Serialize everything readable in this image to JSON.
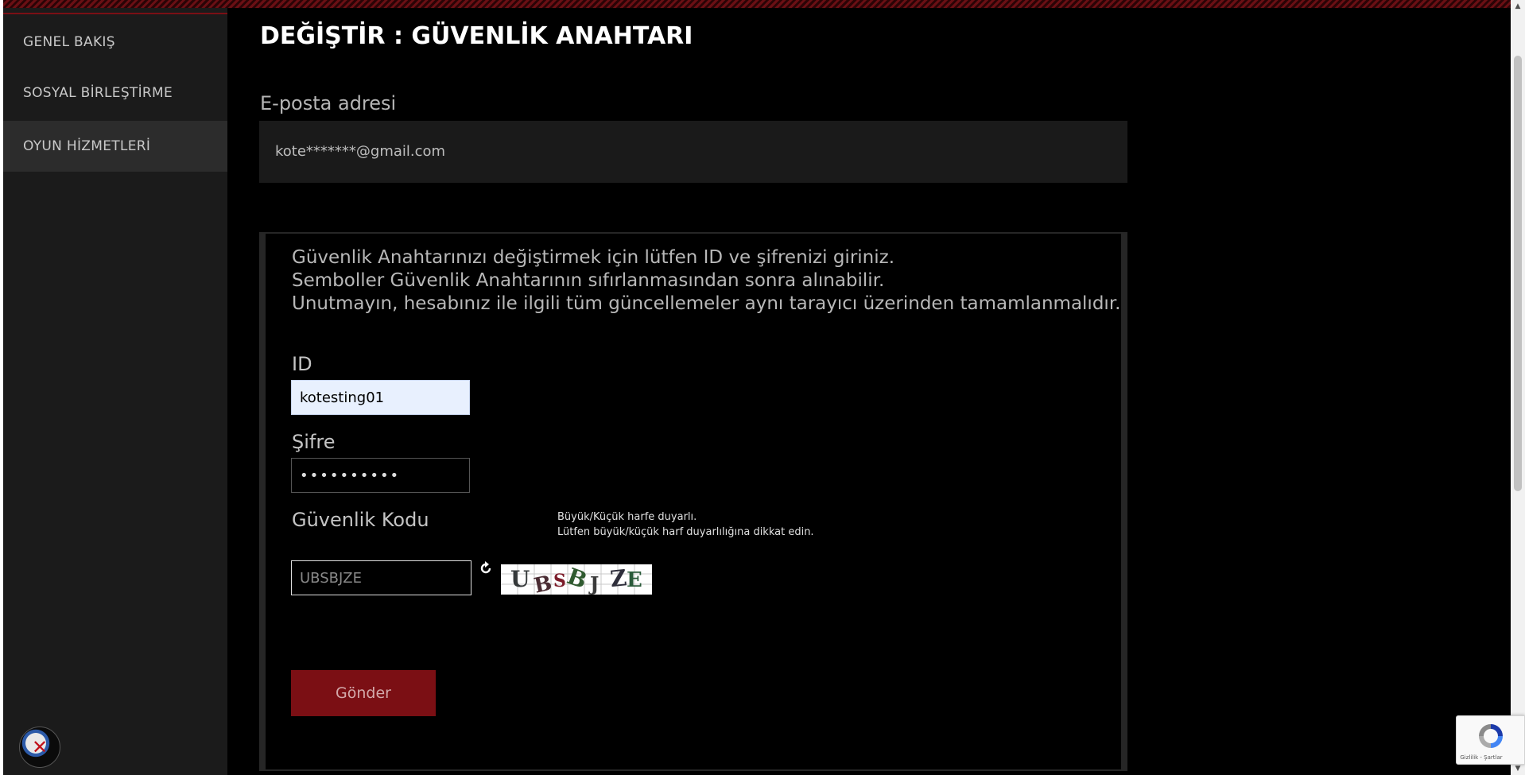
{
  "sidebar": {
    "items": [
      {
        "label": "GENEL BAKIŞ",
        "active": false
      },
      {
        "label": "SOSYAL BİRLEŞTİRME",
        "active": false
      },
      {
        "label": "OYUN HİZMETLERİ",
        "active": true
      }
    ],
    "logo_icon": "game-logo-icon"
  },
  "page": {
    "title": "DEĞİŞTİR : GÜVENLİK ANAHTARI"
  },
  "email": {
    "label": "E-posta adresi",
    "value": "kote*******@gmail.com"
  },
  "form": {
    "instructions": [
      "Güvenlik Anahtarınızı değiştirmek için lütfen ID ve şifrenizi giriniz.",
      "Semboller Güvenlik Anahtarının sıfırlanmasından sonra alınabilir.",
      "Unutmayın, hesabınız ile ilgili tüm güncellemeler aynı tarayıcı üzerinden tamamlanmalıdır."
    ],
    "id_label": "ID",
    "id_value": "kotesting01",
    "password_label": "Şifre",
    "password_value": "••••••••••",
    "security_code_label": "Güvenlik Kodu",
    "case_note_line1": "Büyük/Küçük harfe duyarlı.",
    "case_note_line2": "Lütfen büyük/küçük harf duyarlılığına dikkat edin.",
    "captcha_placeholder": "UBSBJZE",
    "captcha_text": "UBSBJZE",
    "refresh_icon": "refresh-icon",
    "submit_label": "Gönder"
  },
  "recaptcha": {
    "terms": "Gizlilik - Şartlar"
  },
  "colors": {
    "accent": "#7b0f14",
    "background": "#000000",
    "sidebar": "#1b1b1b"
  }
}
